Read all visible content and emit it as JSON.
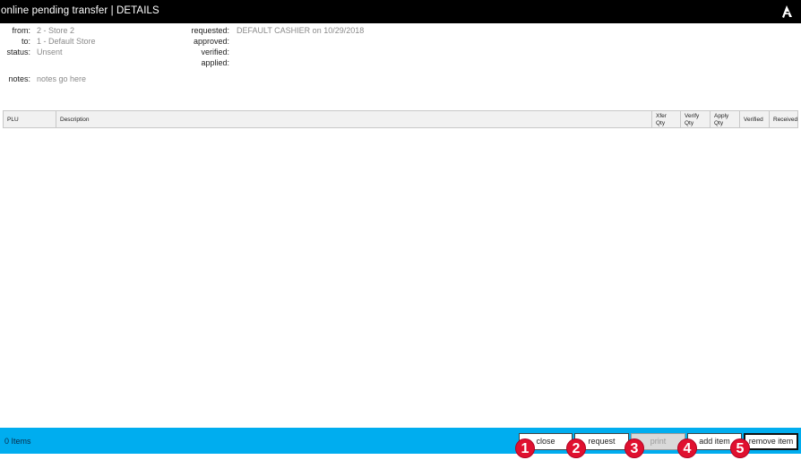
{
  "header": {
    "title": "online pending transfer | DETAILS",
    "logo_icon": "app-logo-icon"
  },
  "details_left": {
    "from_label": "from:",
    "from_value": "2 - Store 2",
    "to_label": "to:",
    "to_value": "1 - Default Store",
    "status_label": "status:",
    "status_value": "Unsent",
    "notes_label": "notes:",
    "notes_value": "notes go here"
  },
  "details_right": {
    "requested_label": "requested:",
    "requested_value": "DEFAULT CASHIER on 10/29/2018",
    "approved_label": "approved:",
    "verified_label": "verified:",
    "applied_label": "applied:"
  },
  "grid": {
    "columns": [
      {
        "line1": "PLU",
        "line2": ""
      },
      {
        "line1": "Description",
        "line2": ""
      },
      {
        "line1": "Xfer",
        "line2": "Qty"
      },
      {
        "line1": "Verify",
        "line2": "Qty"
      },
      {
        "line1": "Apply",
        "line2": "Qty"
      },
      {
        "line1": "Verified",
        "line2": ""
      },
      {
        "line1": "Received",
        "line2": ""
      }
    ],
    "rows": []
  },
  "footer": {
    "items_count": "0 Items",
    "buttons": {
      "close": "close",
      "request": "request",
      "print": "print",
      "add_item": "add item",
      "remove_item": "remove item"
    }
  },
  "markers": [
    "1",
    "2",
    "3",
    "4",
    "5"
  ],
  "colors": {
    "titlebar": "#000000",
    "footer": "#00adef",
    "marker": "#e0102f"
  }
}
